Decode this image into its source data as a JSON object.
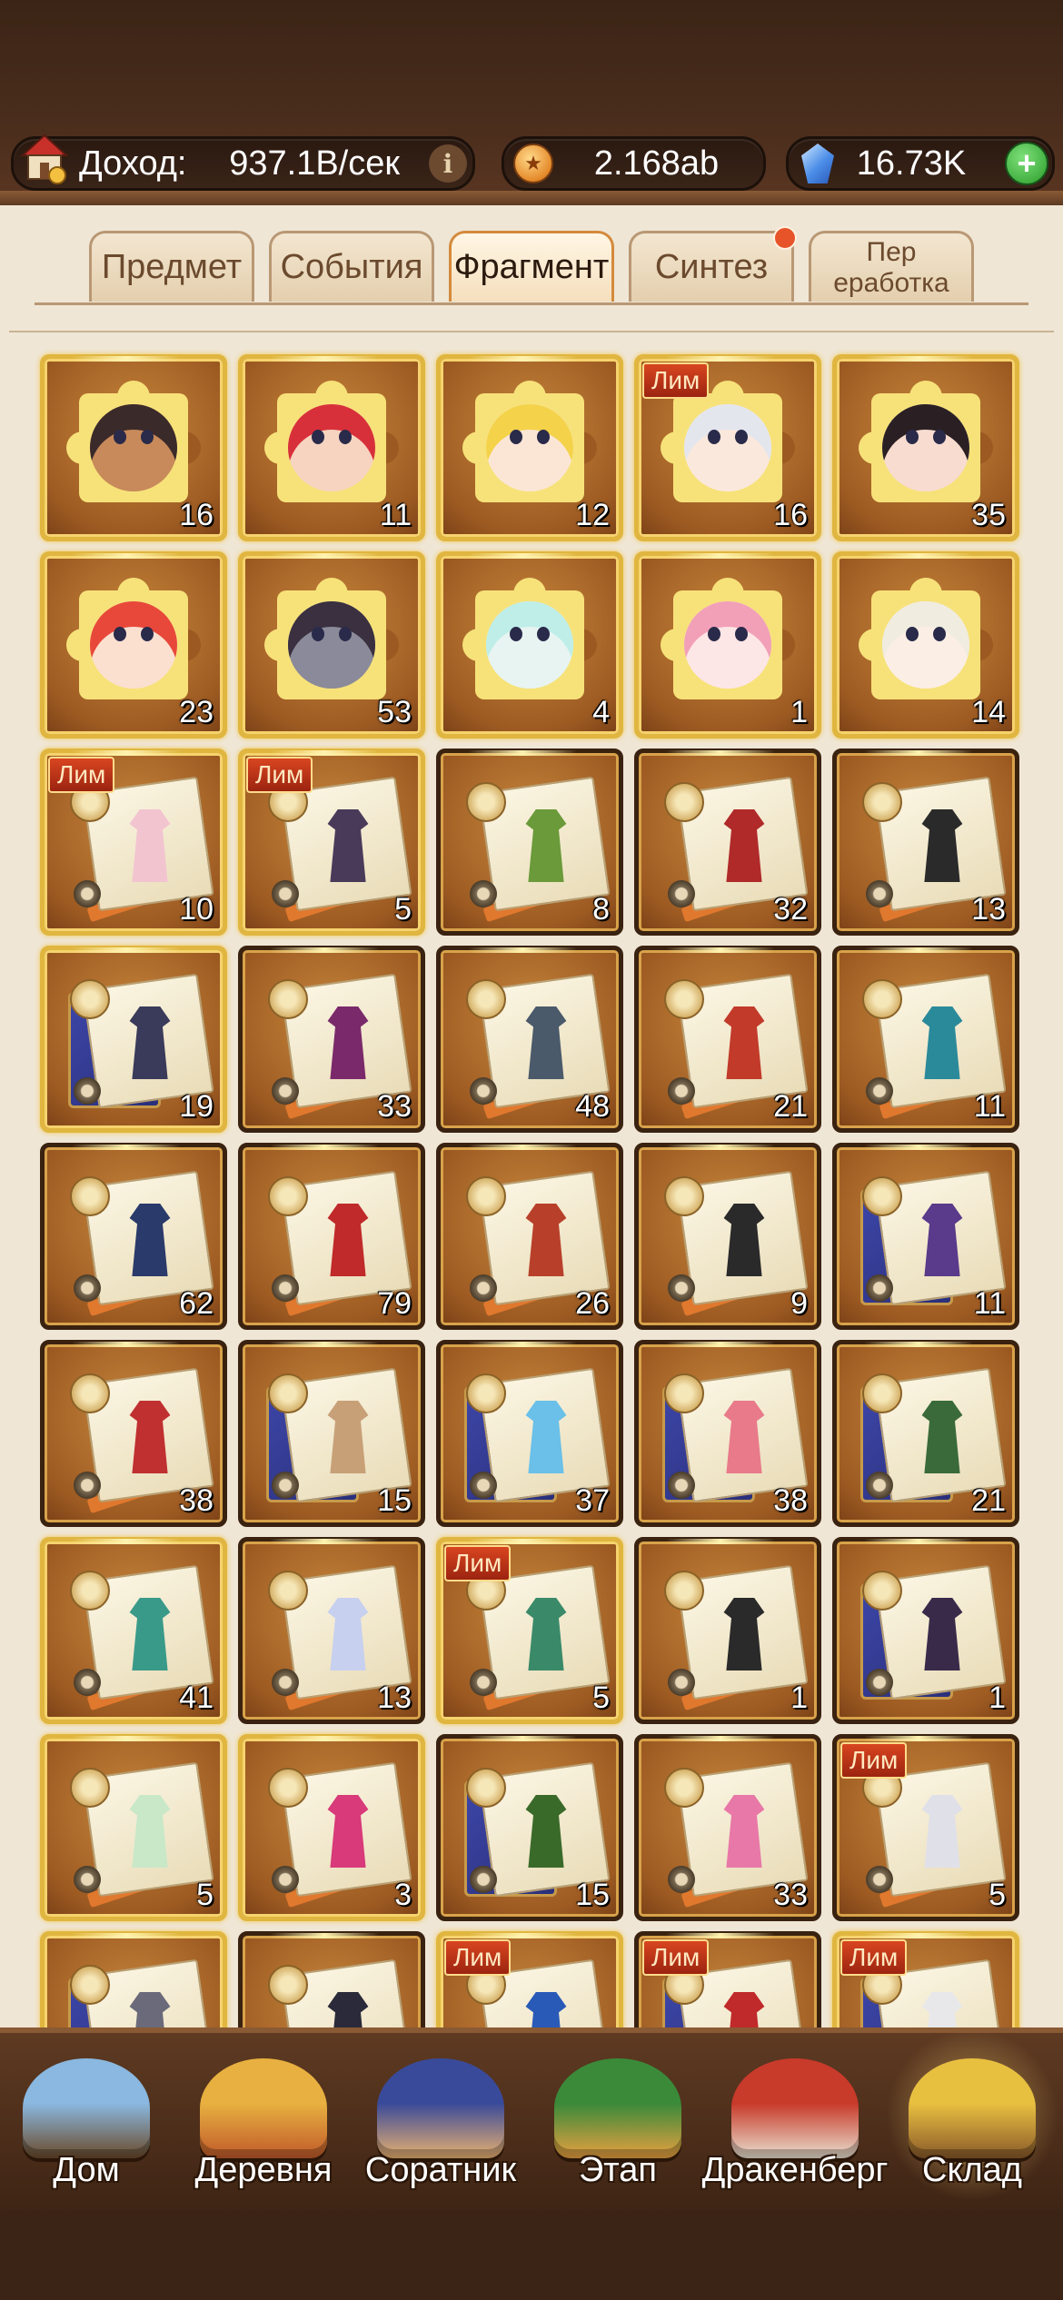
{
  "header": {
    "income_label": "Доход:",
    "income_value": "937.1B/сек",
    "info_symbol": "i",
    "coin_value": "2.168ab",
    "gem_value": "16.73K",
    "plus_symbol": "+"
  },
  "tabs": [
    {
      "label": "Предмет"
    },
    {
      "label": "События"
    },
    {
      "label": "Фрагмент"
    },
    {
      "label": "Синтез"
    },
    {
      "label": "Пер\nеработка"
    }
  ],
  "lim_label": "Лим",
  "items": [
    {
      "kind": "puzzle",
      "count": "16",
      "lim": false,
      "gold": true,
      "hair": "#3b2a2a",
      "skin": "#c88a5a"
    },
    {
      "kind": "puzzle",
      "count": "11",
      "lim": false,
      "gold": true,
      "hair": "#d8303a",
      "skin": "#f6d4c0"
    },
    {
      "kind": "puzzle",
      "count": "12",
      "lim": false,
      "gold": true,
      "hair": "#f4d24a",
      "skin": "#fbe6d6"
    },
    {
      "kind": "puzzle",
      "count": "16",
      "lim": true,
      "gold": true,
      "hair": "#e4e6ee",
      "skin": "#fbe8dc"
    },
    {
      "kind": "puzzle",
      "count": "35",
      "lim": false,
      "gold": true,
      "hair": "#2a2024",
      "skin": "#f8dcd0"
    },
    {
      "kind": "puzzle",
      "count": "23",
      "lim": false,
      "gold": true,
      "hair": "#e8483a",
      "skin": "#fbe0d0"
    },
    {
      "kind": "puzzle",
      "count": "53",
      "lim": false,
      "gold": true,
      "hair": "#3a3040",
      "skin": "#8a8a9a"
    },
    {
      "kind": "puzzle",
      "count": "4",
      "lim": false,
      "gold": true,
      "hair": "#bfeee8",
      "skin": "#e8f4f2"
    },
    {
      "kind": "puzzle",
      "count": "1",
      "lim": false,
      "gold": true,
      "hair": "#f2a0b8",
      "skin": "#fde6e6"
    },
    {
      "kind": "puzzle",
      "count": "14",
      "lim": false,
      "gold": true,
      "hair": "#f0ece0",
      "skin": "#fbeee4"
    },
    {
      "kind": "scroll",
      "count": "10",
      "lim": true,
      "gold": true,
      "book": false,
      "outfit": "#f2c4d0"
    },
    {
      "kind": "scroll",
      "count": "5",
      "lim": true,
      "gold": true,
      "book": false,
      "outfit": "#4a3a5a"
    },
    {
      "kind": "scroll",
      "count": "8",
      "lim": false,
      "gold": false,
      "book": false,
      "outfit": "#6a9a3a"
    },
    {
      "kind": "scroll",
      "count": "32",
      "lim": false,
      "gold": false,
      "book": false,
      "outfit": "#b02a2a"
    },
    {
      "kind": "scroll",
      "count": "13",
      "lim": false,
      "gold": false,
      "book": false,
      "outfit": "#2a2a2a"
    },
    {
      "kind": "scroll",
      "count": "19",
      "lim": false,
      "gold": true,
      "book": true,
      "outfit": "#3a3a5a"
    },
    {
      "kind": "scroll",
      "count": "33",
      "lim": false,
      "gold": false,
      "book": false,
      "outfit": "#7a2a6a"
    },
    {
      "kind": "scroll",
      "count": "48",
      "lim": false,
      "gold": false,
      "book": false,
      "outfit": "#4a5a6a"
    },
    {
      "kind": "scroll",
      "count": "21",
      "lim": false,
      "gold": false,
      "book": false,
      "outfit": "#c23a2a"
    },
    {
      "kind": "scroll",
      "count": "11",
      "lim": false,
      "gold": false,
      "book": false,
      "outfit": "#2a8a9a"
    },
    {
      "kind": "scroll",
      "count": "62",
      "lim": false,
      "gold": false,
      "book": false,
      "outfit": "#2a3a6a"
    },
    {
      "kind": "scroll",
      "count": "79",
      "lim": false,
      "gold": false,
      "book": false,
      "outfit": "#c02a2a"
    },
    {
      "kind": "scroll",
      "count": "26",
      "lim": false,
      "gold": false,
      "book": false,
      "outfit": "#b8402a"
    },
    {
      "kind": "scroll",
      "count": "9",
      "lim": false,
      "gold": false,
      "book": false,
      "outfit": "#2a2a2a"
    },
    {
      "kind": "scroll",
      "count": "11",
      "lim": false,
      "gold": false,
      "book": true,
      "outfit": "#5a3a8a"
    },
    {
      "kind": "scroll",
      "count": "38",
      "lim": false,
      "gold": false,
      "book": false,
      "outfit": "#c03030"
    },
    {
      "kind": "scroll",
      "count": "15",
      "lim": false,
      "gold": false,
      "book": true,
      "outfit": "#c8a078"
    },
    {
      "kind": "scroll",
      "count": "37",
      "lim": false,
      "gold": false,
      "book": true,
      "outfit": "#6ac0e8"
    },
    {
      "kind": "scroll",
      "count": "38",
      "lim": false,
      "gold": false,
      "book": true,
      "outfit": "#e87a8a"
    },
    {
      "kind": "scroll",
      "count": "21",
      "lim": false,
      "gold": false,
      "book": true,
      "outfit": "#3a6a3a"
    },
    {
      "kind": "scroll",
      "count": "41",
      "lim": false,
      "gold": true,
      "book": false,
      "outfit": "#3a9a8a"
    },
    {
      "kind": "scroll",
      "count": "13",
      "lim": false,
      "gold": false,
      "book": false,
      "outfit": "#c8d0f0"
    },
    {
      "kind": "scroll",
      "count": "5",
      "lim": true,
      "gold": true,
      "book": false,
      "outfit": "#3a8a6a"
    },
    {
      "kind": "scroll",
      "count": "1",
      "lim": false,
      "gold": false,
      "book": false,
      "outfit": "#2a2a2a"
    },
    {
      "kind": "scroll",
      "count": "1",
      "lim": false,
      "gold": false,
      "book": true,
      "outfit": "#3a2a4a"
    },
    {
      "kind": "scroll",
      "count": "5",
      "lim": false,
      "gold": true,
      "book": false,
      "outfit": "#c8e8c8"
    },
    {
      "kind": "scroll",
      "count": "3",
      "lim": false,
      "gold": true,
      "book": false,
      "outfit": "#d83a7a"
    },
    {
      "kind": "scroll",
      "count": "15",
      "lim": false,
      "gold": false,
      "book": true,
      "outfit": "#3a6a2a"
    },
    {
      "kind": "scroll",
      "count": "33",
      "lim": false,
      "gold": false,
      "book": false,
      "outfit": "#e878a8"
    },
    {
      "kind": "scroll",
      "count": "5",
      "lim": true,
      "gold": false,
      "book": false,
      "outfit": "#e0e0e8"
    },
    {
      "kind": "scroll",
      "count": "",
      "lim": false,
      "gold": true,
      "book": true,
      "outfit": "#6a6a7a"
    },
    {
      "kind": "scroll",
      "count": "",
      "lim": false,
      "gold": false,
      "book": false,
      "outfit": "#2a2a3a"
    },
    {
      "kind": "scroll",
      "count": "",
      "lim": true,
      "gold": true,
      "book": false,
      "outfit": "#2a5ab8"
    },
    {
      "kind": "scroll",
      "count": "",
      "lim": true,
      "gold": false,
      "book": true,
      "outfit": "#c02a2a"
    },
    {
      "kind": "scroll",
      "count": "",
      "lim": true,
      "gold": true,
      "book": true,
      "outfit": "#e8e8ea"
    }
  ],
  "nav": [
    {
      "label": "Дом",
      "icon": "home-icon",
      "color1": "#8ab8e0",
      "color2": "#6a4a2a",
      "active": false
    },
    {
      "label": "Деревня",
      "icon": "village-icon",
      "color1": "#e8b040",
      "color2": "#c05a2a",
      "active": false
    },
    {
      "label": "Соратник",
      "icon": "companion-icon",
      "color1": "#3a4a9a",
      "color2": "#e8b070",
      "active": false
    },
    {
      "label": "Этап",
      "icon": "stage-icon",
      "color1": "#3a8a3a",
      "color2": "#e8a040",
      "active": false
    },
    {
      "label": "Дракенберг",
      "icon": "castle-icon",
      "color1": "#c83a2a",
      "color2": "#e8e0d0",
      "active": false
    },
    {
      "label": "Склад",
      "icon": "warehouse-icon",
      "color1": "#e8c040",
      "color2": "#8a5a2a",
      "active": true
    }
  ]
}
